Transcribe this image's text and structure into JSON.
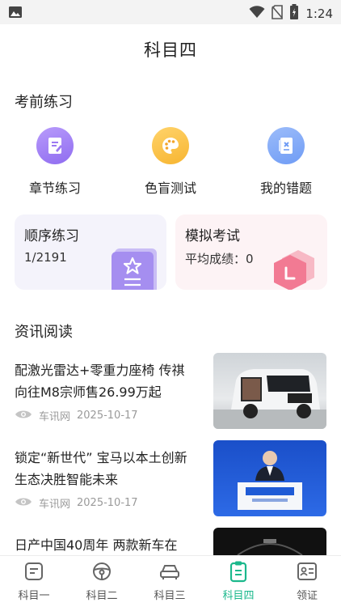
{
  "status_bar": {
    "time": "1:24"
  },
  "header": {
    "title": "科目四"
  },
  "sections": {
    "practice": "考前练习",
    "news": "资讯阅读"
  },
  "quick_actions": [
    {
      "label": "章节练习",
      "icon": "chapter-practice-icon",
      "color": "#8f6cf0"
    },
    {
      "label": "色盲测试",
      "icon": "palette-icon",
      "color": "#f7b531"
    },
    {
      "label": "我的错题",
      "icon": "wrong-questions-icon",
      "color": "#6f9cf5"
    }
  ],
  "cards": {
    "sequential": {
      "title": "顺序练习",
      "progress": "1/2191"
    },
    "mock_exam": {
      "title": "模拟考试",
      "avg_label": "平均成绩：",
      "avg_value": "0"
    }
  },
  "news": [
    {
      "title": "配激光雷达+零重力座椅 传祺向往M8宗师售26.99万起",
      "source": "车讯网",
      "date": "2025-10-17"
    },
    {
      "title": "锁定“新世代” 宝马以本土创新生态决胜智能未来",
      "source": "车讯网",
      "date": "2025-10-17"
    },
    {
      "title": "日产中国40周年 两款新车在",
      "source": "",
      "date": ""
    }
  ],
  "tabs": [
    {
      "label": "科目一",
      "icon": "subject-one-icon",
      "active": false
    },
    {
      "label": "科目二",
      "icon": "steering-wheel-icon",
      "active": false
    },
    {
      "label": "科目三",
      "icon": "car-icon",
      "active": false
    },
    {
      "label": "科目四",
      "icon": "clipboard-icon",
      "active": true
    },
    {
      "label": "领证",
      "icon": "id-card-icon",
      "active": false
    }
  ],
  "colors": {
    "accent": "#1bb88c",
    "underline": "#9be3c5"
  }
}
